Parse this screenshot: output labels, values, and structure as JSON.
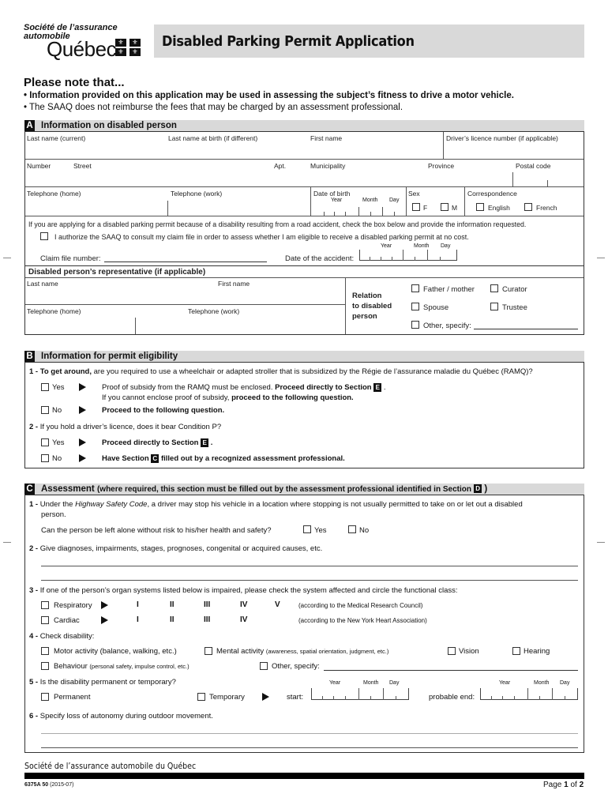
{
  "header": {
    "logo_line1": "Société de l’assurance",
    "logo_line2": "automobile",
    "logo_quebec": "Québec",
    "title": "Disabled Parking Permit Application"
  },
  "notes": {
    "title": "Please note that...",
    "items": [
      "Information provided on this application may be used in assessing the subject’s fitness to drive a motor vehicle.",
      "The SAAQ does not reimburse the fees that may be charged by an assessment professional."
    ]
  },
  "sectionA": {
    "letter": "A",
    "title": "Information on disabled person",
    "fields": {
      "last_name": "Last name (current)",
      "last_name_birth": "Last name at birth (if different)",
      "first_name": "First name",
      "licence": "Driver’s licence number (if applicable)",
      "number": "Number",
      "street": "Street",
      "apt": "Apt.",
      "municipality": "Municipality",
      "province": "Province",
      "postal": "Postal code",
      "tel_home": "Telephone (home)",
      "tel_work": "Telephone (work)",
      "dob": "Date of birth",
      "year": "Year",
      "month": "Month",
      "day": "Day",
      "sex": "Sex",
      "sex_f": "F",
      "sex_m": "M",
      "correspondence": "Correspondence",
      "english": "English",
      "french": "French"
    },
    "accident": {
      "intro": "If you are applying for a disabled parking permit because of a disability resulting from a road accident, check the box below and provide the information requested.",
      "authorize": "I authorize the SAAQ to consult my claim file in order to assess whether I am eligible to receive a disabled parking permit at no cost.",
      "claim": "Claim file number:",
      "date": "Date of the accident:",
      "year": "Year",
      "month": "Month",
      "day": "Day"
    },
    "representative": {
      "title": "Disabled person’s representative (if applicable)",
      "last_name": "Last name",
      "first_name": "First name",
      "tel_home": "Telephone (home)",
      "tel_work": "Telephone (work)",
      "relation_1": "Relation",
      "relation_2": "to disabled",
      "relation_3": "person",
      "father_mother": "Father / mother",
      "curator": "Curator",
      "spouse": "Spouse",
      "trustee": "Trustee",
      "other": "Other, specify:"
    }
  },
  "sectionB": {
    "letter": "B",
    "title": "Information for permit eligibility",
    "q1_num": "1 - ",
    "q1_bold": "To get around,",
    "q1_text": " are you required to use a wheelchair or adapted stroller that is subsidized by the Régie de l’assurance maladie du Québec (RAMQ)?",
    "yes": "Yes",
    "no": "No",
    "q1_yes_text": "Proof of subsidy from the RAMQ must be enclosed. ",
    "q1_yes_bold": "Proceed directly to Section",
    "q1_yes_letter": "E",
    "q1_yes_line2": "If you cannot enclose proof of subsidy, ",
    "q1_yes_line2_bold": "proceed to the following question.",
    "q1_no_text": "Proceed to the following question.",
    "q2_num": "2 - ",
    "q2_text": "If you hold a driver’s licence, does it bear Condition P?",
    "q2_yes_text": "Proceed directly to Section",
    "q2_yes_letter": "E",
    "q2_no_text1": "Have Section",
    "q2_no_letter": "C",
    "q2_no_text2": "filled out by a recognized assessment professional."
  },
  "sectionC": {
    "letter": "C",
    "title": "Assessment",
    "subtitle": "(where required, this section must be filled out by the assessment professional identified in Section",
    "subtitle_letter": "D",
    "q1_num": "1 - ",
    "q1_a": "Under the ",
    "q1_italic": "Highway Safety Code",
    "q1_b": ", a driver may stop his vehicle in a location where stopping is not usually permitted to take on or let out a disabled",
    "q1_c": "person.",
    "q1_question": "Can the person be left alone without risk to his/her health and safety?",
    "yes": "Yes",
    "no": "No",
    "q2_num": "2 - ",
    "q2_text": "Give diagnoses, impairments, stages, prognoses, congenital or acquired causes, etc.",
    "q3_num": "3 - ",
    "q3_text": "If one of the person’s organ systems listed below is impaired, please check the system affected and circle the functional class:",
    "respiratory": "Respiratory",
    "cardiac": "Cardiac",
    "classes_resp": [
      "I",
      "II",
      "III",
      "IV",
      "V"
    ],
    "classes_card": [
      "I",
      "II",
      "III",
      "IV"
    ],
    "resp_note": "(according to the Medical Research Council)",
    "card_note": "(according to the New York Heart Association)",
    "q4_num": "4 - ",
    "q4_text": "Check disability:",
    "motor": "Motor activity (balance, walking, etc.)",
    "mental": "Mental activity",
    "mental_note": "(awareness, spatial orientation, judgment, etc.)",
    "vision": "Vision",
    "hearing": "Hearing",
    "behaviour": "Behaviour",
    "behaviour_note": "(personal safety, impulse control, etc.)",
    "other": "Other, specify:",
    "q5_num": "5 - ",
    "q5_text": "Is the disability permanent or temporary?",
    "permanent": "Permanent",
    "temporary": "Temporary",
    "start": "start:",
    "probable_end": "probable end:",
    "year": "Year",
    "month": "Month",
    "day": "Day",
    "q6_num": "6 - ",
    "q6_text": "Specify loss of autonomy during outdoor movement."
  },
  "footer": {
    "org": "Société de l’assurance automobile du Québec",
    "form_code": "6375A 50",
    "form_date": "(2015-07)",
    "page_label": "Page ",
    "page_num": "1",
    "page_of": " of ",
    "page_total": "2"
  }
}
